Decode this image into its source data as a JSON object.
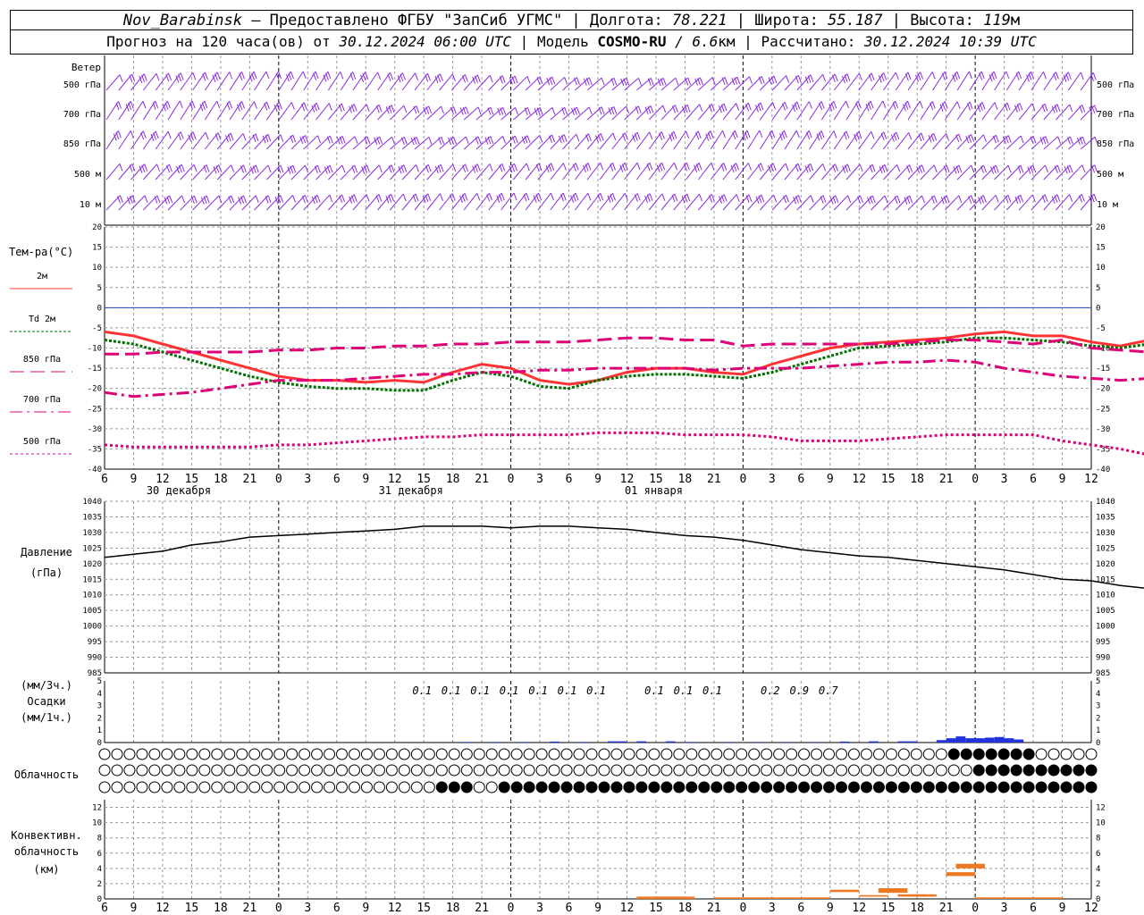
{
  "header": {
    "station": "Nov_Barabinsk",
    "dash": " — ",
    "provider": "Предоставлено ФГБУ \"ЗапСиб УГМС\"",
    "lon_label": "Долгота:",
    "lon_value": "78.221",
    "lat_label": "Широта:",
    "lat_value": "55.187",
    "alt_label": "Высота:",
    "alt_value": "119",
    "alt_unit": "м",
    "forecast_label": "Прогноз на 120 часа(ов) от",
    "forecast_start": "30.12.2024 06:00 UTC",
    "model_label": "Модель",
    "model_name": "COSMO-RU",
    "model_res": "/ 6.6",
    "model_res_unit": "км",
    "calc_label": "Рассчитано:",
    "calc_time": "30.12.2024 10:39 UTC"
  },
  "colors": {
    "wind": "#8a2be2",
    "t2m": "#ff3333",
    "td2m": "#007000",
    "t850": "#dd0077",
    "t700": "#dd0077",
    "t500": "#dd0077",
    "zero_line": "#2244cc",
    "pressure": "#000000",
    "precip_bar": "#2233dd",
    "conv_bar": "#ee7722",
    "grid": "#999999"
  },
  "chart_data": {
    "time_axis": {
      "hour_labels": [
        "6",
        "9",
        "12",
        "15",
        "18",
        "21",
        "0",
        "3",
        "6",
        "9",
        "12",
        "15",
        "18",
        "21",
        "0",
        "3",
        "6",
        "9",
        "12",
        "15",
        "18",
        "21",
        "0",
        "3",
        "6",
        "9",
        "12",
        "15",
        "18",
        "21",
        "0",
        "3",
        "6",
        "9",
        "12"
      ],
      "day_labels": [
        "30 декабря",
        "31 декабря",
        "01 января"
      ],
      "midnight_indices": [
        6,
        14,
        22,
        30
      ]
    },
    "wind": {
      "title": "Ветер",
      "levels": [
        "500 гПа",
        "700 гПа",
        "850 гПа",
        "500 м",
        "10 м"
      ]
    },
    "temperature": {
      "type": "line",
      "title": "Тем-ра(°C)",
      "ylim": [
        -40,
        20
      ],
      "yticks": [
        20,
        15,
        10,
        5,
        0,
        -5,
        -10,
        -15,
        -20,
        -25,
        -30,
        -35,
        -40
      ],
      "series": [
        {
          "name": "2м",
          "key": "t2m",
          "values": [
            -6,
            -7,
            -9,
            -11,
            -13,
            -15,
            -17,
            -18,
            -18,
            -18.5,
            -18,
            -18.5,
            -16,
            -14,
            -15,
            -18,
            -19,
            -18,
            -16,
            -15,
            -15,
            -16,
            -16.5,
            -14,
            -12,
            -10,
            -9,
            -8.5,
            -8,
            -7.5,
            -6.5,
            -6,
            -7,
            -7,
            -8.5,
            -9.5,
            -8,
            -7,
            -6,
            -5
          ],
          "x_step": 1.5,
          "dash": "solid"
        },
        {
          "name": "Td 2м",
          "key": "td2m",
          "values": [
            -8,
            -9,
            -11,
            -13,
            -15,
            -17,
            -18.5,
            -19.5,
            -20,
            -20,
            -20.5,
            -20.5,
            -18,
            -16,
            -17,
            -19.5,
            -20,
            -18,
            -17,
            -16.5,
            -16.5,
            -17,
            -17.5,
            -16,
            -14,
            -12,
            -10,
            -9.5,
            -9,
            -8.5,
            -7.5,
            -7.5,
            -8,
            -8.5,
            -9.5,
            -10,
            -9,
            -7.5,
            -6.5,
            -5.5
          ],
          "x_step": 1.5,
          "dash": "dotted"
        },
        {
          "name": "850 гПа",
          "key": "t850",
          "values": [
            -11.5,
            -11.5,
            -11,
            -11,
            -11,
            -11,
            -10.5,
            -10.5,
            -10,
            -10,
            -9.5,
            -9.5,
            -9,
            -9,
            -8.5,
            -8.5,
            -8.5,
            -8,
            -7.5,
            -7.5,
            -8,
            -8,
            -9.5,
            -9,
            -9,
            -9,
            -9,
            -9,
            -8.5,
            -8,
            -8,
            -8.5,
            -9,
            -8,
            -10,
            -10.5,
            -11,
            -13,
            -12.5,
            -13
          ],
          "x_step": 1.5,
          "dash": "longdash"
        },
        {
          "name": "700 гПа",
          "key": "t700",
          "values": [
            -21,
            -22,
            -21.5,
            -21,
            -20,
            -19,
            -18,
            -18,
            -18,
            -17.5,
            -17,
            -16.5,
            -16.5,
            -16,
            -16,
            -15.5,
            -15.5,
            -15,
            -15,
            -15,
            -15,
            -15.5,
            -15,
            -15,
            -15,
            -14.5,
            -14,
            -13.5,
            -13.5,
            -13,
            -13.5,
            -15,
            -16,
            -17,
            -17.5,
            -18,
            -17.5,
            -18,
            -20,
            -23
          ],
          "x_step": 1.5,
          "dash": "dashdot"
        },
        {
          "name": "500 гПа",
          "key": "t500",
          "values": [
            -34,
            -34.5,
            -34.5,
            -34.5,
            -34.5,
            -34.5,
            -34,
            -34,
            -33.5,
            -33,
            -32.5,
            -32,
            -32,
            -31.5,
            -31.5,
            -31.5,
            -31.5,
            -31,
            -31,
            -31,
            -31.5,
            -31.5,
            -31.5,
            -32,
            -33,
            -33,
            -33,
            -32.5,
            -32,
            -31.5,
            -31.5,
            -31.5,
            -31.5,
            -33,
            -34,
            -35,
            -36.5,
            -38,
            -40,
            -42
          ],
          "x_step": 1.5,
          "dash": "dot"
        }
      ]
    },
    "pressure": {
      "type": "line",
      "title": "Давление",
      "unit": "(гПа)",
      "ylim": [
        985,
        1040
      ],
      "yticks": [
        1040,
        1035,
        1030,
        1025,
        1020,
        1015,
        1010,
        1005,
        1000,
        995,
        990,
        985
      ],
      "values": [
        1022,
        1023,
        1024,
        1026,
        1027,
        1028.5,
        1029,
        1029.5,
        1030,
        1030.5,
        1031,
        1032,
        1032,
        1032,
        1031.5,
        1032,
        1032,
        1031.5,
        1031,
        1030,
        1029,
        1028.5,
        1027.5,
        1026,
        1024.5,
        1023.5,
        1022.5,
        1022,
        1021,
        1020,
        1019,
        1018,
        1016.5,
        1015,
        1014.5,
        1013,
        1012,
        1011.5,
        1012,
        1012.5
      ],
      "x_step": 1.5
    },
    "precipitation": {
      "type": "bar",
      "title": "Осадки",
      "unit3": "(мм/3ч.)",
      "unit1": "(мм/1ч.)",
      "ylim": [
        0,
        5
      ],
      "yticks": [
        "5",
        "4",
        "3",
        "2",
        "1",
        "0"
      ],
      "amount_labels": [
        {
          "i": 11,
          "text": "0.1"
        },
        {
          "i": 12,
          "text": "0.1"
        },
        {
          "i": 13,
          "text": "0.1"
        },
        {
          "i": 14,
          "text": "0.1"
        },
        {
          "i": 15,
          "text": "0.1"
        },
        {
          "i": 16,
          "text": "0.1"
        },
        {
          "i": 17,
          "text": "0.1"
        },
        {
          "i": 19,
          "text": "0.1"
        },
        {
          "i": 20,
          "text": "0.1"
        },
        {
          "i": 21,
          "text": "0.1"
        },
        {
          "i": 23,
          "text": "0.2"
        },
        {
          "i": 24,
          "text": "0.9"
        },
        {
          "i": 25,
          "text": "0.7"
        }
      ],
      "hourly": [
        {
          "h": 37,
          "v": 0.05
        },
        {
          "h": 40,
          "v": 0.05
        },
        {
          "h": 43,
          "v": 0.05
        },
        {
          "h": 46,
          "v": 0.08
        },
        {
          "h": 49,
          "v": 0.05
        },
        {
          "h": 52,
          "v": 0.1
        },
        {
          "h": 53,
          "v": 0.1
        },
        {
          "h": 55,
          "v": 0.1
        },
        {
          "h": 58,
          "v": 0.1
        },
        {
          "h": 60,
          "v": 0.05
        },
        {
          "h": 64,
          "v": 0.05
        },
        {
          "h": 67,
          "v": 0.05
        },
        {
          "h": 70,
          "v": 0.05
        },
        {
          "h": 73,
          "v": 0.05
        },
        {
          "h": 76,
          "v": 0.08
        },
        {
          "h": 79,
          "v": 0.1
        },
        {
          "h": 82,
          "v": 0.1
        },
        {
          "h": 83,
          "v": 0.1
        },
        {
          "h": 86,
          "v": 0.2
        },
        {
          "h": 87,
          "v": 0.35
        },
        {
          "h": 88,
          "v": 0.5
        },
        {
          "h": 89,
          "v": 0.35
        },
        {
          "h": 90,
          "v": 0.35
        },
        {
          "h": 91,
          "v": 0.4
        },
        {
          "h": 92,
          "v": 0.45
        },
        {
          "h": 93,
          "v": 0.35
        },
        {
          "h": 94,
          "v": 0.25
        }
      ]
    },
    "cloudiness": {
      "title": "Облачность",
      "rows": 3
    },
    "convective": {
      "type": "bar",
      "title": "Конвективн.",
      "title2": "облачность",
      "unit": "(км)",
      "ylim": [
        0,
        13
      ],
      "yticks": [
        "12",
        "10",
        "8",
        "6",
        "4",
        "2",
        "0"
      ],
      "bars": [
        {
          "h": 55,
          "base": 0,
          "top": 0.3
        },
        {
          "h": 56,
          "base": 0,
          "top": 0.3
        },
        {
          "h": 57,
          "base": 0,
          "top": 0.3
        },
        {
          "h": 58,
          "base": 0,
          "top": 0.3
        },
        {
          "h": 63,
          "base": 0,
          "top": 0.2
        },
        {
          "h": 66,
          "base": 0,
          "top": 0.2
        },
        {
          "h": 69,
          "base": 0,
          "top": 0.2
        },
        {
          "h": 72,
          "base": 0,
          "top": 0.2
        },
        {
          "h": 75,
          "base": 0.9,
          "top": 1.2
        },
        {
          "h": 78,
          "base": 0.3,
          "top": 0.5
        },
        {
          "h": 80,
          "base": 0.8,
          "top": 1.4
        },
        {
          "h": 82,
          "base": 0.3,
          "top": 0.6
        },
        {
          "h": 83,
          "base": 0.3,
          "top": 0.6
        },
        {
          "h": 87,
          "base": 3,
          "top": 3.5
        },
        {
          "h": 88,
          "base": 4,
          "top": 4.6
        },
        {
          "h": 90,
          "base": 0,
          "top": 0.2
        },
        {
          "h": 93,
          "base": 0,
          "top": 0.2
        },
        {
          "h": 96,
          "base": 0,
          "top": 0.2
        }
      ]
    }
  }
}
